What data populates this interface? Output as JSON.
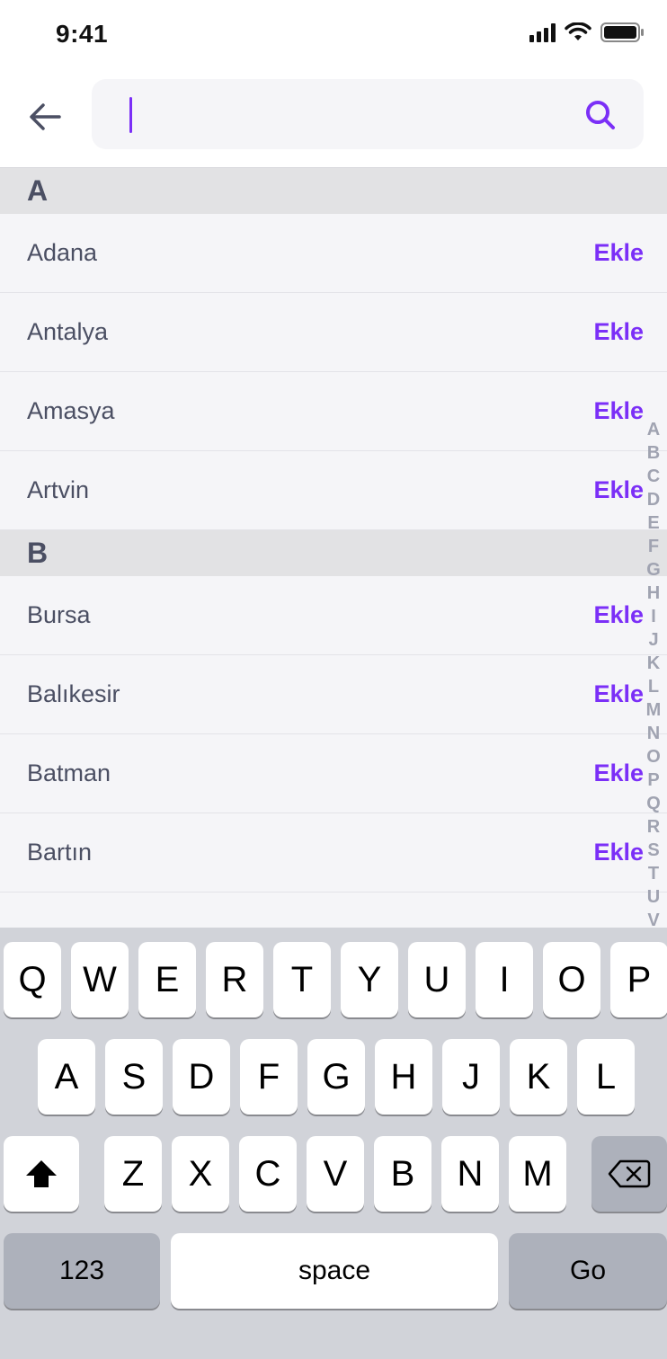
{
  "status": {
    "time": "9:41"
  },
  "search": {
    "placeholder": "",
    "value": ""
  },
  "sections": [
    {
      "letter": "A",
      "items": [
        {
          "name": "Adana",
          "action": "Ekle"
        },
        {
          "name": "Antalya",
          "action": "Ekle"
        },
        {
          "name": "Amasya",
          "action": "Ekle"
        },
        {
          "name": "Artvin",
          "action": "Ekle"
        }
      ]
    },
    {
      "letter": "B",
      "items": [
        {
          "name": "Bursa",
          "action": "Ekle"
        },
        {
          "name": "Balıkesir",
          "action": "Ekle"
        },
        {
          "name": "Batman",
          "action": "Ekle"
        },
        {
          "name": "Bartın",
          "action": "Ekle"
        }
      ]
    }
  ],
  "alphabet_index": [
    "A",
    "B",
    "C",
    "D",
    "E",
    "F",
    "G",
    "H",
    "I",
    "J",
    "K",
    "L",
    "M",
    "N",
    "O",
    "P",
    "Q",
    "R",
    "S",
    "T",
    "U",
    "V"
  ],
  "keyboard": {
    "row1": [
      "Q",
      "W",
      "E",
      "R",
      "T",
      "Y",
      "U",
      "I",
      "O",
      "P"
    ],
    "row2": [
      "A",
      "S",
      "D",
      "F",
      "G",
      "H",
      "J",
      "K",
      "L"
    ],
    "row3": [
      "Z",
      "X",
      "C",
      "V",
      "B",
      "N",
      "M"
    ],
    "numbers_label": "123",
    "space_label": "space",
    "go_label": "Go"
  },
  "colors": {
    "accent": "#7b2ff7",
    "list_background": "#f5f5f8",
    "section_header": "#e2e2e4",
    "text": "#4b4f63",
    "keyboard_background": "#d1d3d9"
  },
  "icons": [
    "back-arrow-icon",
    "search-icon",
    "shift-icon",
    "backspace-icon",
    "signal-icon",
    "wifi-icon",
    "battery-icon"
  ]
}
